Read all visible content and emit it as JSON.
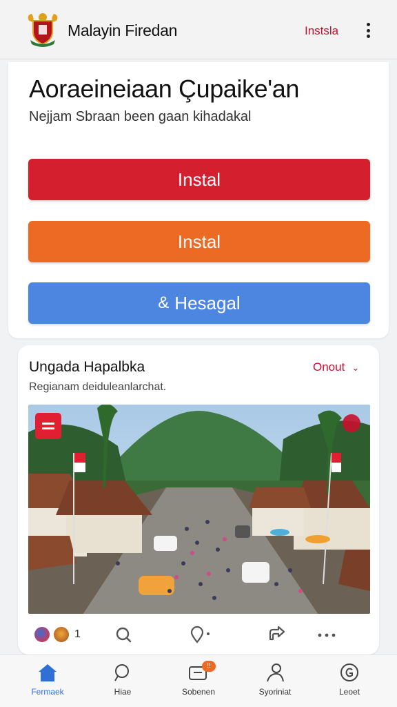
{
  "app_bar": {
    "title": "Malayin Firedan",
    "install_link": "Instsla",
    "logo_icon": "coat-of-arms-icon",
    "menu_icon": "more-vert-icon"
  },
  "hero": {
    "headline": "Aoraeineiaan Çupaike'an",
    "subline": "Nejjam Sbraan been gaan kihadakal",
    "buttons": [
      {
        "label": "Instal",
        "color": "#d41f2f"
      },
      {
        "label": "Instal",
        "color": "#ec6a24"
      },
      {
        "label": "Hesagal",
        "glyph": "&",
        "color": "#4d86e0"
      }
    ]
  },
  "post": {
    "title": "Ungada Hapalbka",
    "subtitle": "Regianam deiduleanlarchat.",
    "dropdown_label": "Onout",
    "image_icons": [
      "flag-badge-icon",
      "emblem-icon"
    ],
    "reaction_count": "1",
    "actions": [
      "search-icon",
      "location-icon",
      "share-icon",
      "more-horiz-icon"
    ]
  },
  "bottom_nav": {
    "items": [
      {
        "label": "Fermaek",
        "icon": "home-icon",
        "active": true
      },
      {
        "label": "Hiae",
        "icon": "search-icon",
        "active": false
      },
      {
        "label": "Sobenen",
        "icon": "message-icon",
        "active": false,
        "badge": "!!"
      },
      {
        "label": "Syoriniat",
        "icon": "people-icon",
        "active": false
      },
      {
        "label": "Leoet",
        "icon": "g-circle-icon",
        "active": false
      }
    ]
  },
  "colors": {
    "accent_red": "#c8102e",
    "button_red": "#d41f2f",
    "button_orange": "#ec6a24",
    "button_blue": "#4d86e0",
    "nav_active": "#2f6fd6"
  }
}
